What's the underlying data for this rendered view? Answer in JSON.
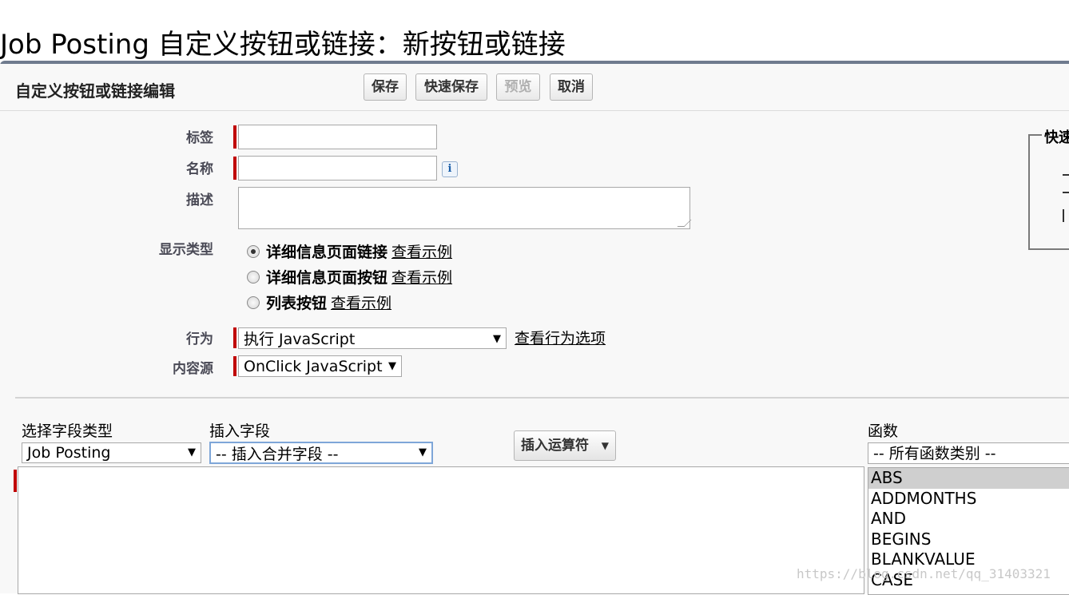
{
  "page": {
    "title": "Job Posting 自定义按钮或链接：新按钮或链接"
  },
  "panel": {
    "heading": "自定义按钮或链接编辑",
    "buttons": {
      "save": "保存",
      "quick_save": "快速保存",
      "preview": "预览",
      "cancel": "取消"
    }
  },
  "form": {
    "label_label": "标签",
    "label_value": "",
    "name_label": "名称",
    "name_value": "",
    "description_label": "描述",
    "description_value": "",
    "display_type_label": "显示类型",
    "display_types": [
      {
        "label": "详细信息页面链接",
        "link": "查看示例",
        "selected": true
      },
      {
        "label": "详细信息页面按钮",
        "link": "查看示例",
        "selected": false
      },
      {
        "label": "列表按钮",
        "link": "查看示例",
        "selected": false
      }
    ],
    "behavior_label": "行为",
    "behavior_value": "执行 JavaScript",
    "behavior_link": "查看行为选项",
    "content_source_label": "内容源",
    "content_source_value": "OnClick JavaScript"
  },
  "side_panel": {
    "title": "快速"
  },
  "formula": {
    "field_type_label": "选择字段类型",
    "field_type_value": "Job Posting",
    "insert_field_label": "插入字段",
    "insert_field_value": "-- 插入合并字段 --",
    "insert_operator_label": "插入运算符",
    "functions_label": "函数",
    "function_category_value": "-- 所有函数类别 --",
    "functions": [
      "ABS",
      "ADDMONTHS",
      "AND",
      "BEGINS",
      "BLANKVALUE",
      "CASE"
    ],
    "selected_function": "ABS"
  },
  "watermark": "https://blog.csdn.net/qq_31403321",
  "colors": {
    "required_marker": "#c00000",
    "panel_border": "#6f7b8e",
    "panel_bg": "#f8f8f8"
  },
  "icons": [
    "info-icon",
    "chevron-down-icon",
    "resize-grip-icon"
  ]
}
